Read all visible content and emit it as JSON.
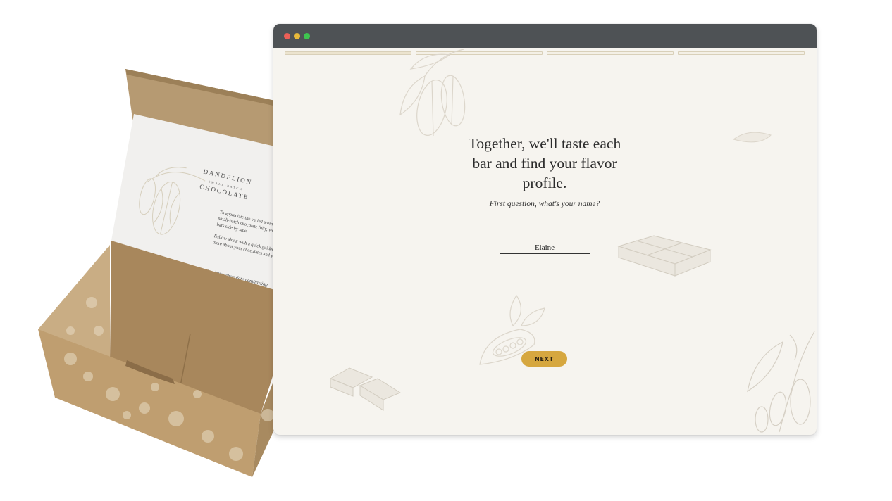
{
  "browser": {
    "window_controls": [
      "close",
      "minimize",
      "maximize"
    ],
    "progress": {
      "total_steps": 4,
      "current_step": 1
    }
  },
  "page": {
    "headline": "Together, we'll taste each bar and find your flavor profile.",
    "question": "First question, what's your name?",
    "name_input": {
      "value": "Elaine"
    },
    "next_label": "NEXT"
  },
  "insert_card": {
    "brand_top": "DANDELION",
    "brand_sub": "SMALL-BATCH",
    "brand_bottom": "CHOCOLATE",
    "paragraph1": [
      "To appreciate the varied aromas and flavors of",
      "small-batch chocolate fully, we recommend tasting",
      "bars side by side."
    ],
    "paragraph2": [
      "Follow along with a quick guided tour to learn",
      "more about your chocolates and your taste profile."
    ],
    "url": "dandelionchocolate.com/tasting"
  },
  "colors": {
    "titlebar": "#4e5255",
    "page_bg": "#f6f4ef",
    "button": "#d6a73f",
    "kraft": "#b79a70"
  }
}
